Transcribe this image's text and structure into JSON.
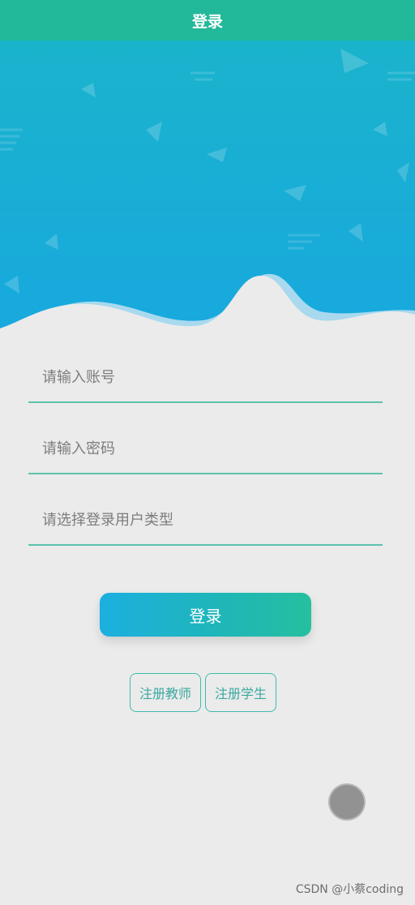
{
  "nav": {
    "title": "登录"
  },
  "form": {
    "account_placeholder": "请输入账号",
    "password_placeholder": "请输入密码",
    "usertype_placeholder": "请选择登录用户类型"
  },
  "buttons": {
    "login_label": "登录",
    "register_teacher_label": "注册教师",
    "register_student_label": "注册学生"
  },
  "watermark": {
    "text": "CSDN @小蔡coding"
  },
  "colors": {
    "nav": "#22b89a",
    "hero_top": "#1ab3cc",
    "hero_bottom": "#18a9df",
    "accent": "#3fbcae",
    "background": "#ebebeb"
  },
  "icons": {
    "float_button": "circle-icon"
  }
}
